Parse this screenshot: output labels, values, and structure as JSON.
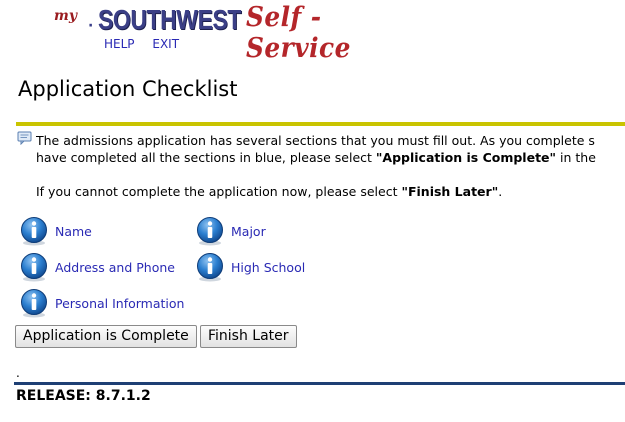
{
  "header": {
    "logo_my": "my",
    "logo_brand": "SOUTHWEST",
    "logo_tagline": "Self - Service",
    "links": {
      "help": "HELP",
      "exit": "EXIT"
    }
  },
  "page": {
    "title": "Application Checklist"
  },
  "message": {
    "line1": "The admissions application has several sections that you must fill out. As you complete s",
    "line2_pre": "have completed all the sections in blue, please select ",
    "line2_bold": "\"Application is Complete\"",
    "line2_post": " in the",
    "line3_pre": "If you cannot complete the application now, please select ",
    "line3_bold": "\"Finish Later\"",
    "line3_post": "."
  },
  "checklist": {
    "name": "Name",
    "major": "Major",
    "address": "Address and Phone",
    "high_school": "High School",
    "personal": "Personal Information"
  },
  "buttons": {
    "complete": "Application is Complete",
    "finish_later": "Finish Later"
  },
  "footer": {
    "dot": ".",
    "release": "RELEASE: 8.7.1.2"
  },
  "colors": {
    "link": "#2a2ab4",
    "rule_yellow": "#c9c400",
    "rule_blue": "#1e3f74",
    "brand_blue": "#3b3f86",
    "brand_red": "#b4262a"
  },
  "icons": {
    "section": "info-icon",
    "message": "message-icon"
  }
}
